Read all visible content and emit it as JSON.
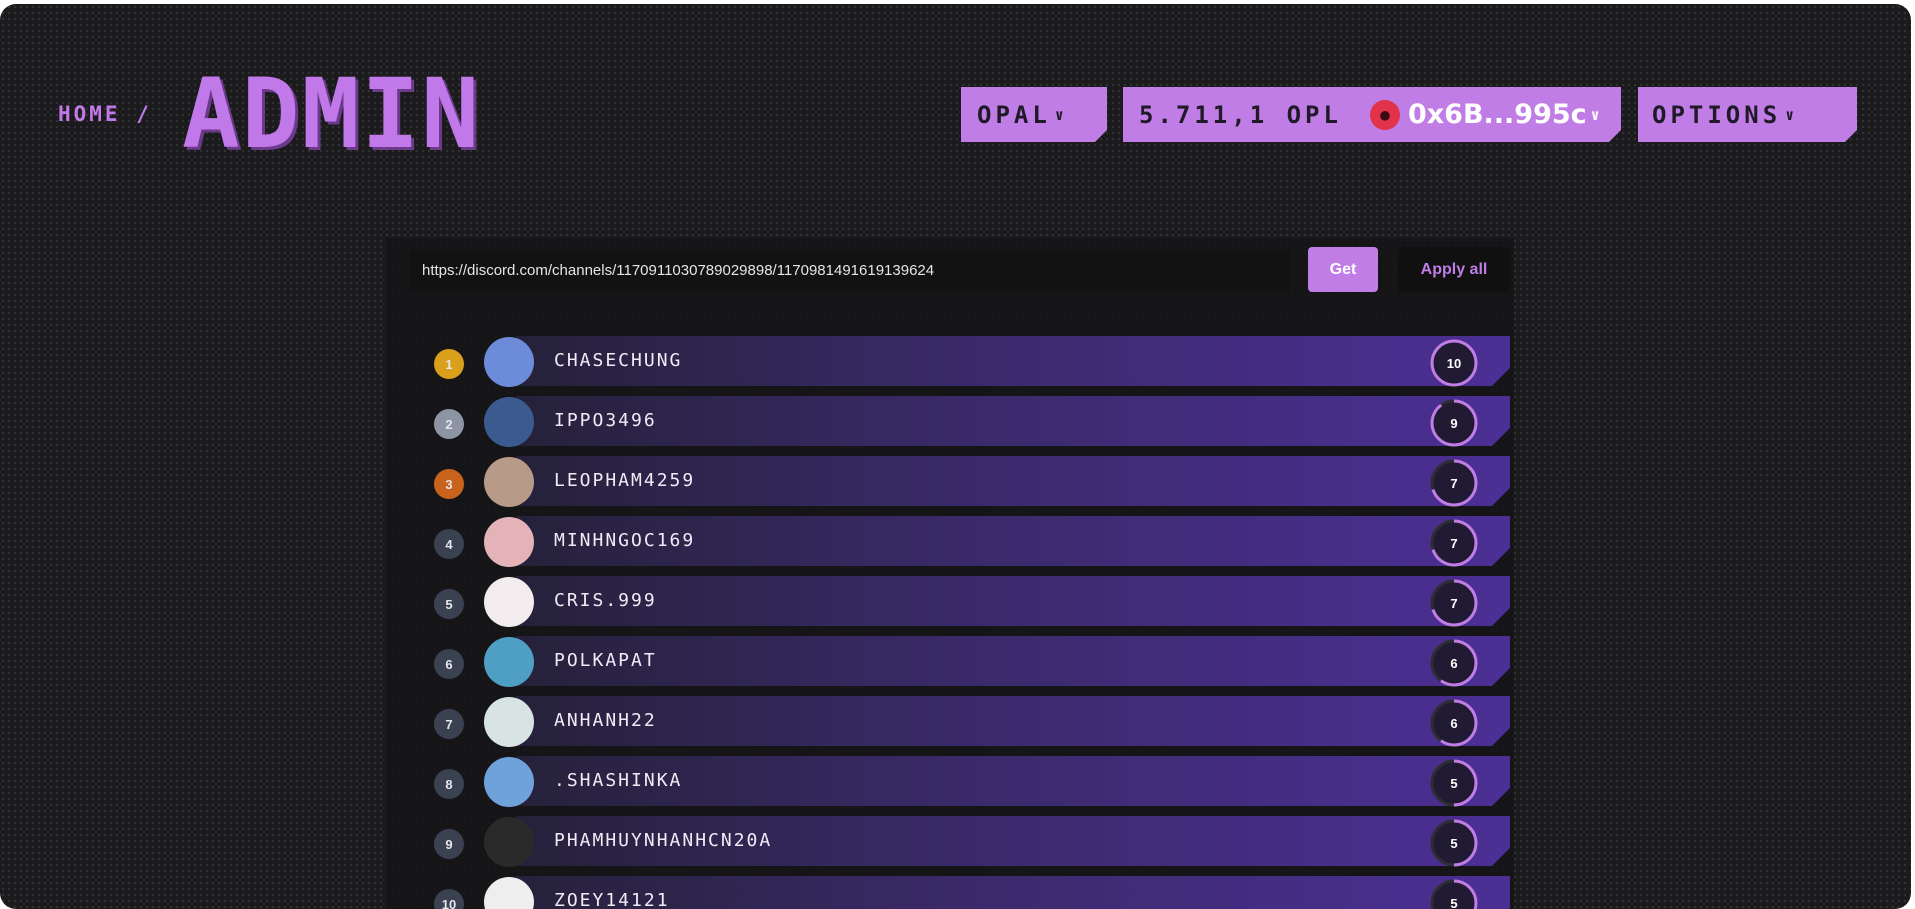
{
  "header": {
    "breadcrumb": "HOME /",
    "title": "ADMIN",
    "network": "OPAL",
    "balance": "5.711,1 OPL",
    "address": "0x6B...995c",
    "options": "OPTIONS"
  },
  "toolbar": {
    "url_value": "https://discord.com/channels/1170911030789029898/1170981491619139624",
    "get_label": "Get",
    "apply_all_label": "Apply all"
  },
  "colors": {
    "accent": "#c07de6",
    "rank_gold": "#d9a01c",
    "rank_silver": "#8d94a3",
    "rank_bronze": "#c9621c",
    "rank_default": "#3a4252",
    "score_ring": "#c07de6"
  },
  "leaderboard": [
    {
      "rank": "1",
      "name": "CHASECHUNG",
      "score": "10",
      "progress": 1.0,
      "avatar": "robot-avatar",
      "avatar_bg": "#6c8cd9"
    },
    {
      "rank": "2",
      "name": "IPPO3496",
      "score": "9",
      "progress": 0.9,
      "avatar": "player-avatar",
      "avatar_bg": "#3b5b8f"
    },
    {
      "rank": "3",
      "name": "LEOPHAM4259",
      "score": "7",
      "progress": 0.7,
      "avatar": "photo-avatar",
      "avatar_bg": "#b89a88"
    },
    {
      "rank": "4",
      "name": "MINHNGOC169",
      "score": "7",
      "progress": 0.7,
      "avatar": "photo-avatar",
      "avatar_bg": "#e3b3b8"
    },
    {
      "rank": "5",
      "name": "CRIS.999",
      "score": "7",
      "progress": 0.7,
      "avatar": "santa-avatar",
      "avatar_bg": "#f3ecee"
    },
    {
      "rank": "6",
      "name": "POLKAPAT",
      "score": "6",
      "progress": 0.6,
      "avatar": "starfish-avatar",
      "avatar_bg": "#4f9fc4"
    },
    {
      "rank": "7",
      "name": "ANHANH22",
      "score": "6",
      "progress": 0.6,
      "avatar": "sketch-avatar",
      "avatar_bg": "#d7e4e3"
    },
    {
      "rank": "8",
      "name": ".SHASHINKA",
      "score": "5",
      "progress": 0.5,
      "avatar": "cartoon-avatar",
      "avatar_bg": "#6fa2db"
    },
    {
      "rank": "9",
      "name": "PHAMHUYNHANHCN20A",
      "score": "5",
      "progress": 0.5,
      "avatar": "photo-avatar",
      "avatar_bg": "#2a2a2a"
    },
    {
      "rank": "10",
      "name": "ZOEY14121",
      "score": "5",
      "progress": 0.5,
      "avatar": "cartoon-avatar",
      "avatar_bg": "#eeeeee"
    }
  ]
}
